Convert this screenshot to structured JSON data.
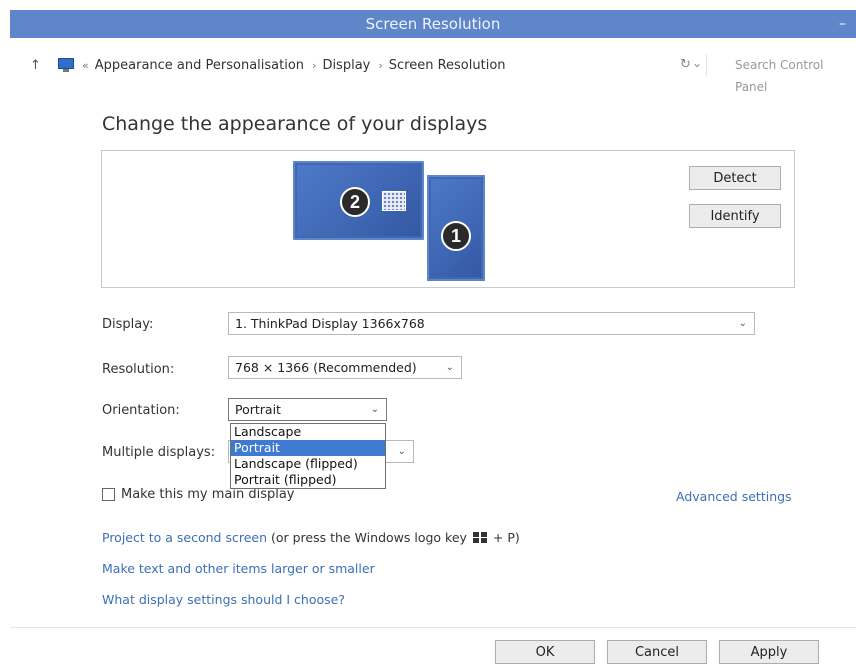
{
  "window": {
    "title": "Screen Resolution",
    "minimize_glyph": "–"
  },
  "address": {
    "up_glyph": "↑",
    "overflow_glyph": "«",
    "separator_glyph": "›",
    "crumbs": [
      "Appearance and Personalisation",
      "Display",
      "Screen Resolution"
    ],
    "dropdown_glyph": "⌄",
    "refresh_glyph": "↻",
    "search_placeholder": "Search Control Panel"
  },
  "page": {
    "heading": "Change the appearance of your displays"
  },
  "monitors": {
    "display_2_number": "2",
    "display_1_number": "1",
    "detect_label": "Detect",
    "identify_label": "Identify"
  },
  "form": {
    "display_label": "Display:",
    "display_value": "1. ThinkPad Display 1366x768",
    "resolution_label": "Resolution:",
    "resolution_value": "768 × 1366 (Recommended)",
    "orientation_label": "Orientation:",
    "orientation_value": "Portrait",
    "orientation_options": [
      "Landscape",
      "Portrait",
      "Landscape (flipped)",
      "Portrait (flipped)"
    ],
    "multiple_label": "Multiple displays:",
    "main_display_label": "Make this my main display",
    "arrow_glyph": "⌄"
  },
  "links": {
    "advanced": "Advanced settings",
    "project_link": "Project to a second screen",
    "project_suffix_a": " (or press the Windows logo key ",
    "project_suffix_b": " + P)",
    "text_size": "Make text and other items larger or smaller",
    "which_settings": "What display settings should I choose?"
  },
  "footer": {
    "ok_label": "OK",
    "cancel_label": "Cancel",
    "apply_label": "Apply"
  }
}
